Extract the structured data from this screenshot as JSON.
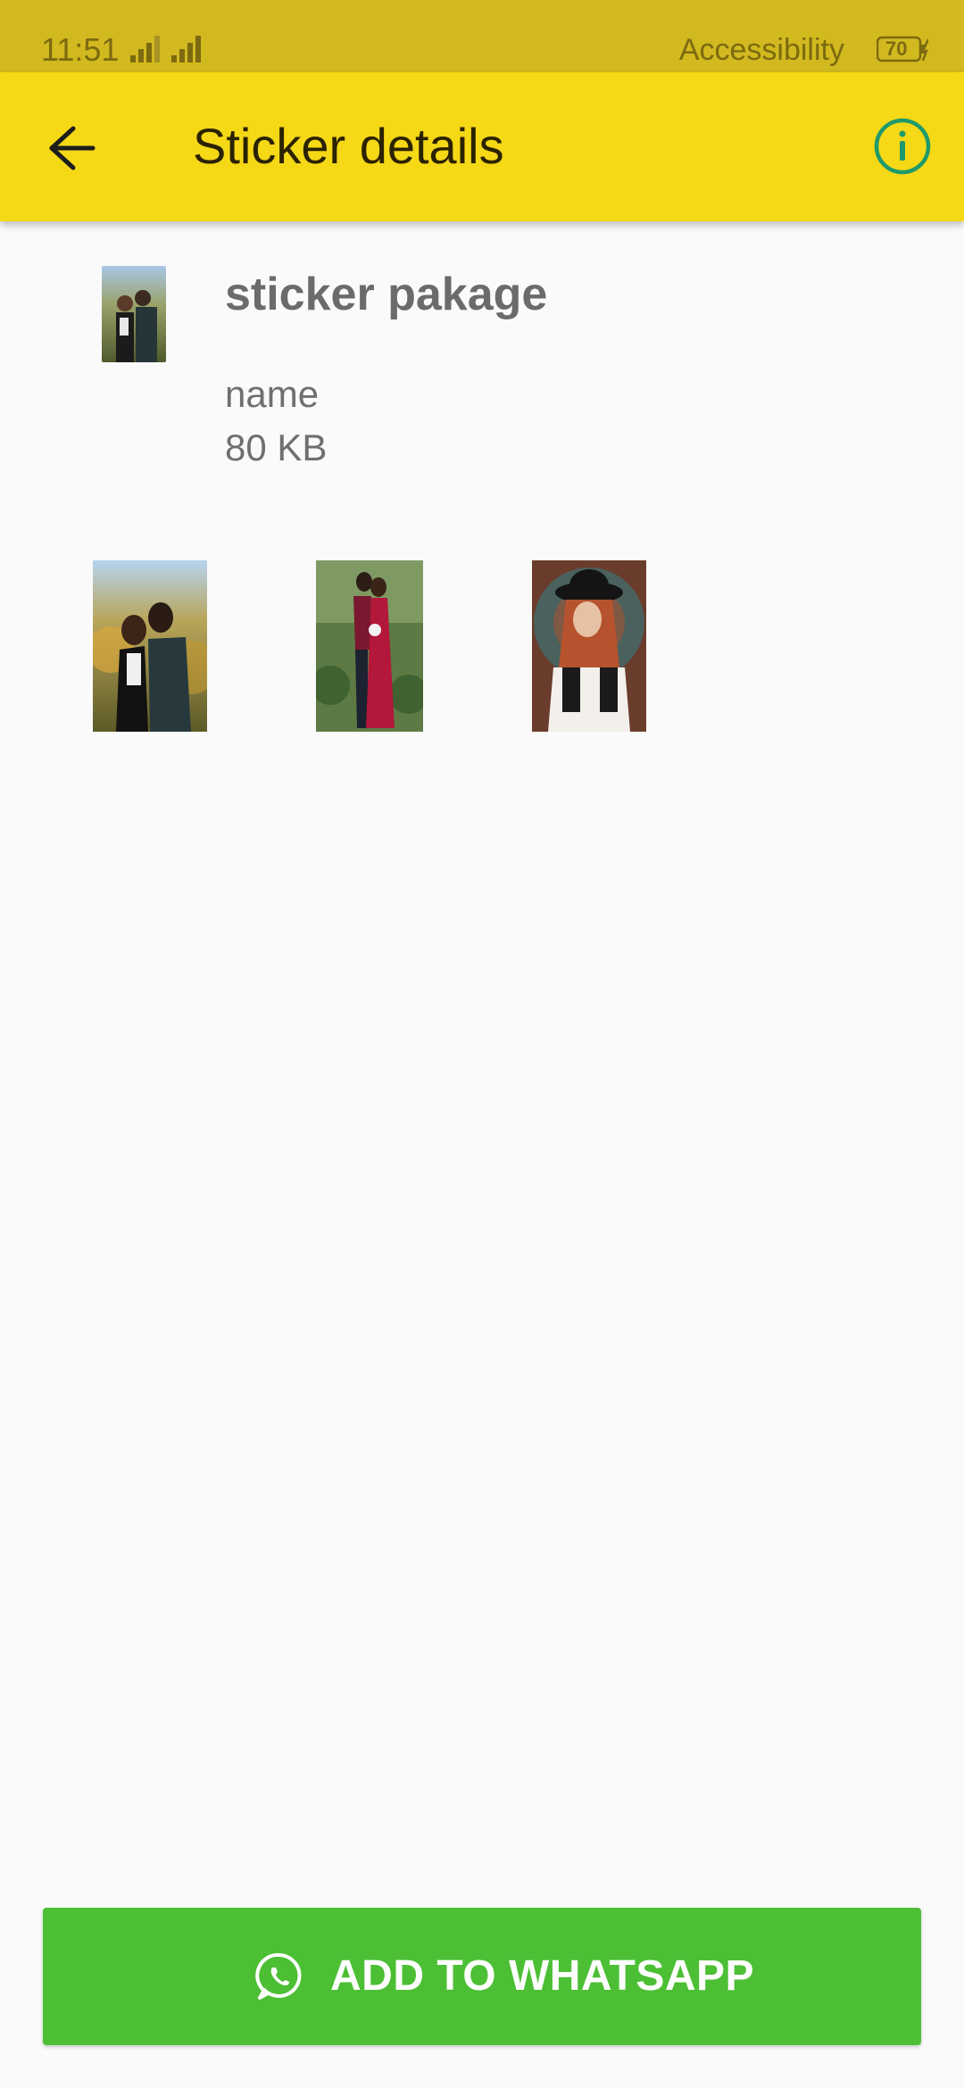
{
  "status_bar": {
    "time": "11:51",
    "accessibility": "Accessibility",
    "battery_level": "70"
  },
  "app_bar": {
    "title": "Sticker details",
    "back_icon": "arrow-back-icon",
    "info_icon": "info-icon"
  },
  "pack": {
    "name": "sticker pakage",
    "author": "name",
    "size": "80 KB"
  },
  "stickers": [
    {
      "desc": "couple-sunset-photo"
    },
    {
      "desc": "couple-garden-photo"
    },
    {
      "desc": "woman-hat-photo"
    }
  ],
  "add_button": {
    "label": "ADD TO WHATSAPP",
    "icon": "whatsapp-icon"
  },
  "colors": {
    "status_bar": "#d2b91f",
    "app_bar": "#f5d816",
    "info_icon": "#1f9a6a",
    "add_button": "#4cbf34"
  }
}
